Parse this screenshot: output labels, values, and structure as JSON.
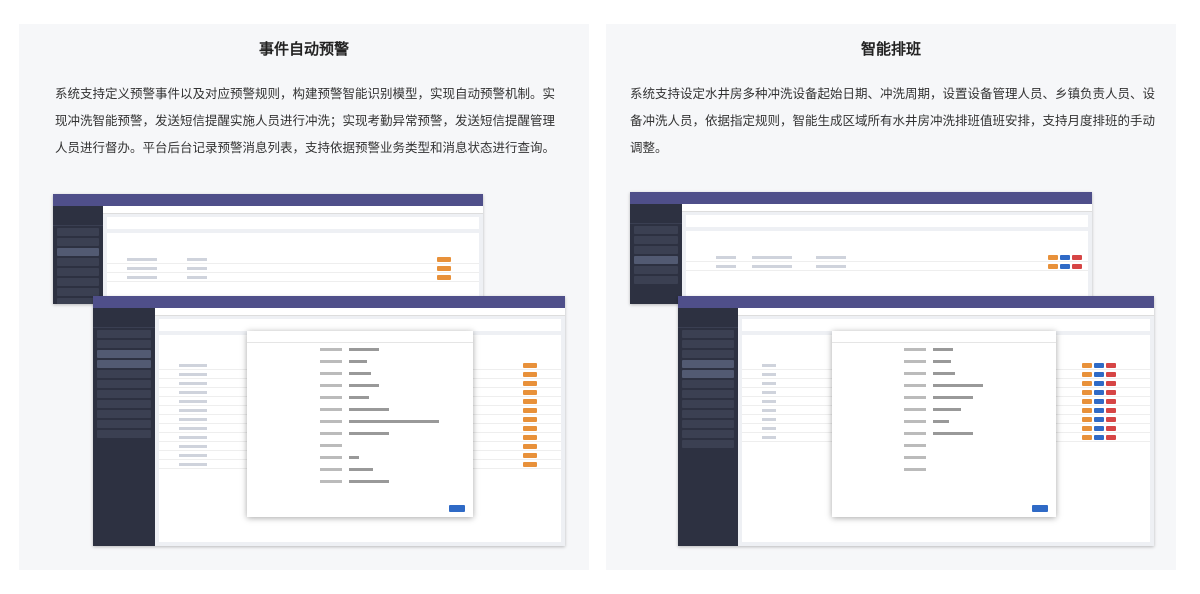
{
  "cards": [
    {
      "title": "事件自动预警",
      "description": "系统支持定义预警事件以及对应预警规则，构建预警智能识别模型，实现自动预警机制。实现冲洗智能预警，发送短信提醒实施人员进行冲洗；实现考勤异常预警，发送短信提醒管理人员进行督办。平台后台记录预警消息列表，支持依据预警业务类型和消息状态进行查询。"
    },
    {
      "title": "智能排班",
      "description": "系统支持设定水井房多种冲洗设备起始日期、冲洗周期，设置设备管理人员、乡镇负责人员、设备冲洗人员，依据指定规则，智能生成区域所有水井房冲洗排班值班安排，支持月度排班的手动调整。"
    }
  ],
  "colors": {
    "topbar": "#4f4f8a",
    "sidebar": "#2d3141",
    "warning_badge": "#e8913a",
    "primary_button": "#2f6ac6"
  }
}
